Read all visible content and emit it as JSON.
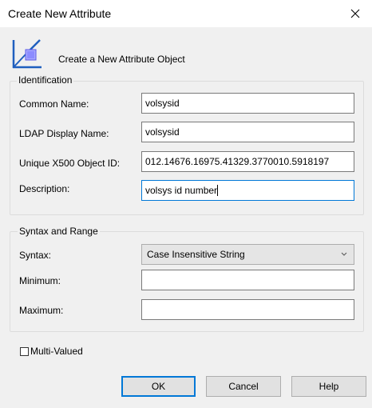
{
  "window": {
    "title": "Create New Attribute",
    "close_icon": "close-icon"
  },
  "header": {
    "icon": "attribute-object-icon",
    "text": "Create a New Attribute Object"
  },
  "identification": {
    "group_label": "Identification",
    "common_name_label": "Common Name:",
    "common_name_value": "volsysid",
    "ldap_label": "LDAP Display Name:",
    "ldap_value": "volsysid",
    "oid_label": "Unique X500 Object ID:",
    "oid_value": "012.14676.16975.41329.3770010.5918197",
    "description_label": "Description:",
    "description_value": "volsys id number"
  },
  "syntax_range": {
    "group_label": "Syntax and Range",
    "syntax_label": "Syntax:",
    "syntax_value": "Case Insensitive String",
    "minimum_label": "Minimum:",
    "minimum_value": "",
    "maximum_label": "Maximum:",
    "maximum_value": ""
  },
  "multivalued": {
    "label": "Multi-Valued",
    "checked": false
  },
  "buttons": {
    "ok": "OK",
    "cancel": "Cancel",
    "help": "Help"
  },
  "colors": {
    "window_bg": "#f0f0f0",
    "focus_border": "#0078d7",
    "icon_accent": "#1f5fbf",
    "icon_fill": "#9999ff"
  }
}
